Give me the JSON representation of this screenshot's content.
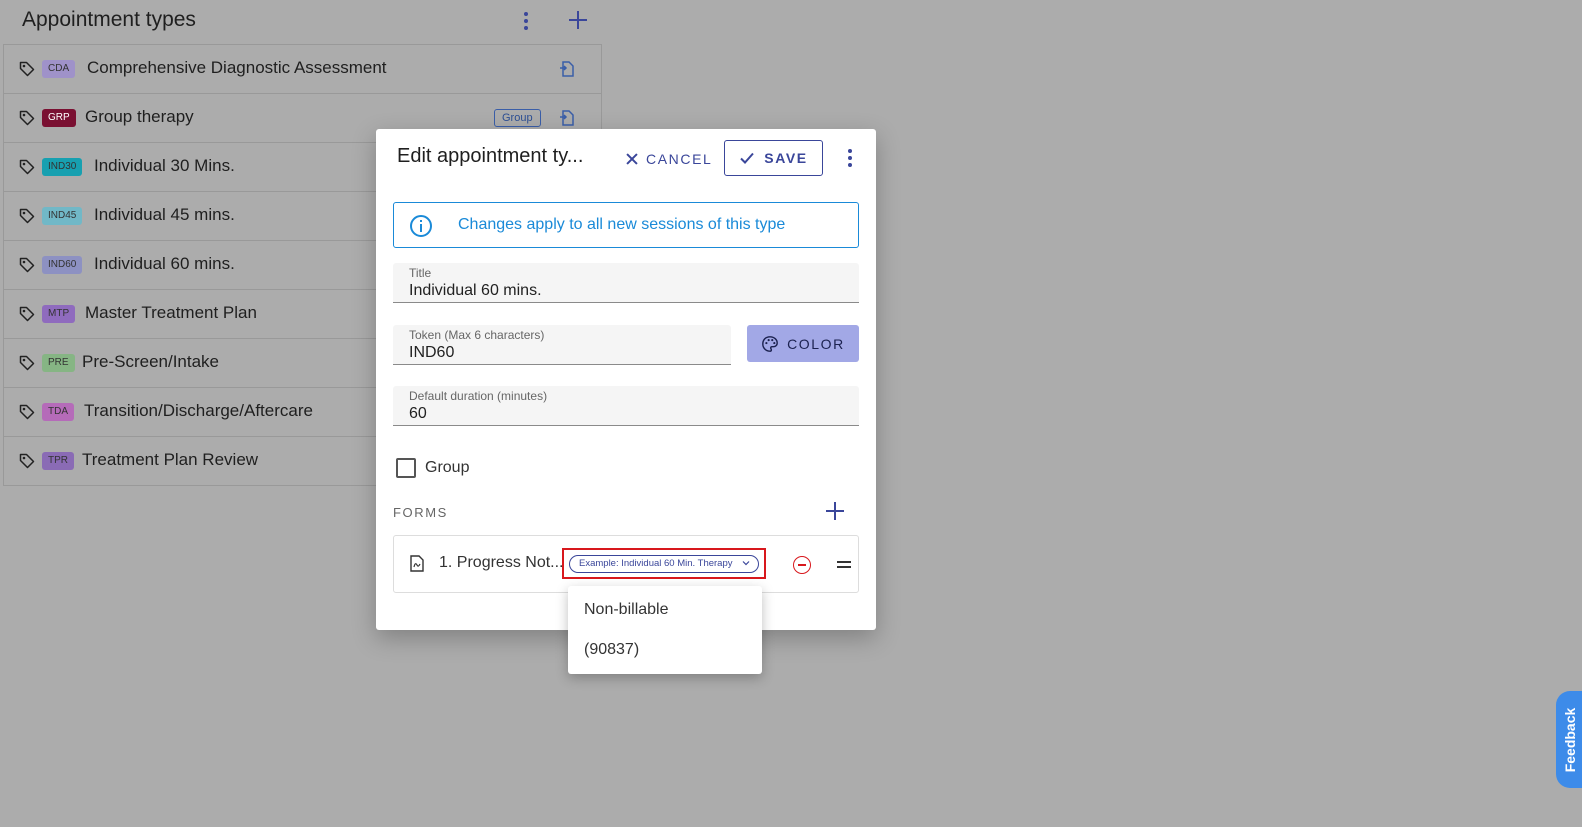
{
  "panel": {
    "title": "Appointment types"
  },
  "appointment_types": [
    {
      "token": "CDA",
      "token_color": "#9f92c9",
      "label": "Comprehensive Diagnostic Assessment",
      "group_chip": ""
    },
    {
      "token": "GRP",
      "token_color": "#7a1032",
      "label": "Group therapy",
      "group_chip": "Group"
    },
    {
      "token": "IND30",
      "token_color": "#17a0b0",
      "label": "Individual 30 Mins.",
      "group_chip": ""
    },
    {
      "token": "IND45",
      "token_color": "#71b8c7",
      "label": "Individual 45 mins.",
      "group_chip": ""
    },
    {
      "token": "IND60",
      "token_color": "#8d91c2",
      "label": "Individual 60 mins.",
      "group_chip": ""
    },
    {
      "token": "MTP",
      "token_color": "#8f6bbe",
      "label": "Master Treatment Plan",
      "group_chip": ""
    },
    {
      "token": "PRE",
      "token_color": "#86b584",
      "label": "Pre-Screen/Intake",
      "group_chip": ""
    },
    {
      "token": "TDA",
      "token_color": "#b56bb9",
      "label": "Transition/Discharge/Aftercare",
      "group_chip": ""
    },
    {
      "token": "TPR",
      "token_color": "#8a6bb5",
      "label": "Treatment Plan Review",
      "group_chip": ""
    }
  ],
  "dialog": {
    "title": "Edit appointment ty...",
    "cancel_label": "CANCEL",
    "save_label": "SAVE",
    "info_text": "Changes apply to all new sessions of this type",
    "title_field": {
      "label": "Title",
      "value": "Individual 60 mins."
    },
    "token_field": {
      "label": "Token (Max 6 characters)",
      "value": "IND60"
    },
    "color_label": "COLOR",
    "duration_field": {
      "label": "Default duration (minutes)",
      "value": "60"
    },
    "group_label": "Group",
    "forms_heading": "FORMS",
    "forms": [
      {
        "name": "1. Progress Not...",
        "billing": "Example: Individual 60 Min. Therapy"
      }
    ]
  },
  "billing_menu": {
    "options": [
      "Non-billable",
      "(90837)"
    ]
  },
  "feedback_label": "Feedback",
  "colors": {
    "primary": "#3a469a",
    "info": "#1a8ad8",
    "danger": "#d8181d",
    "feedback": "#3d8be9"
  }
}
